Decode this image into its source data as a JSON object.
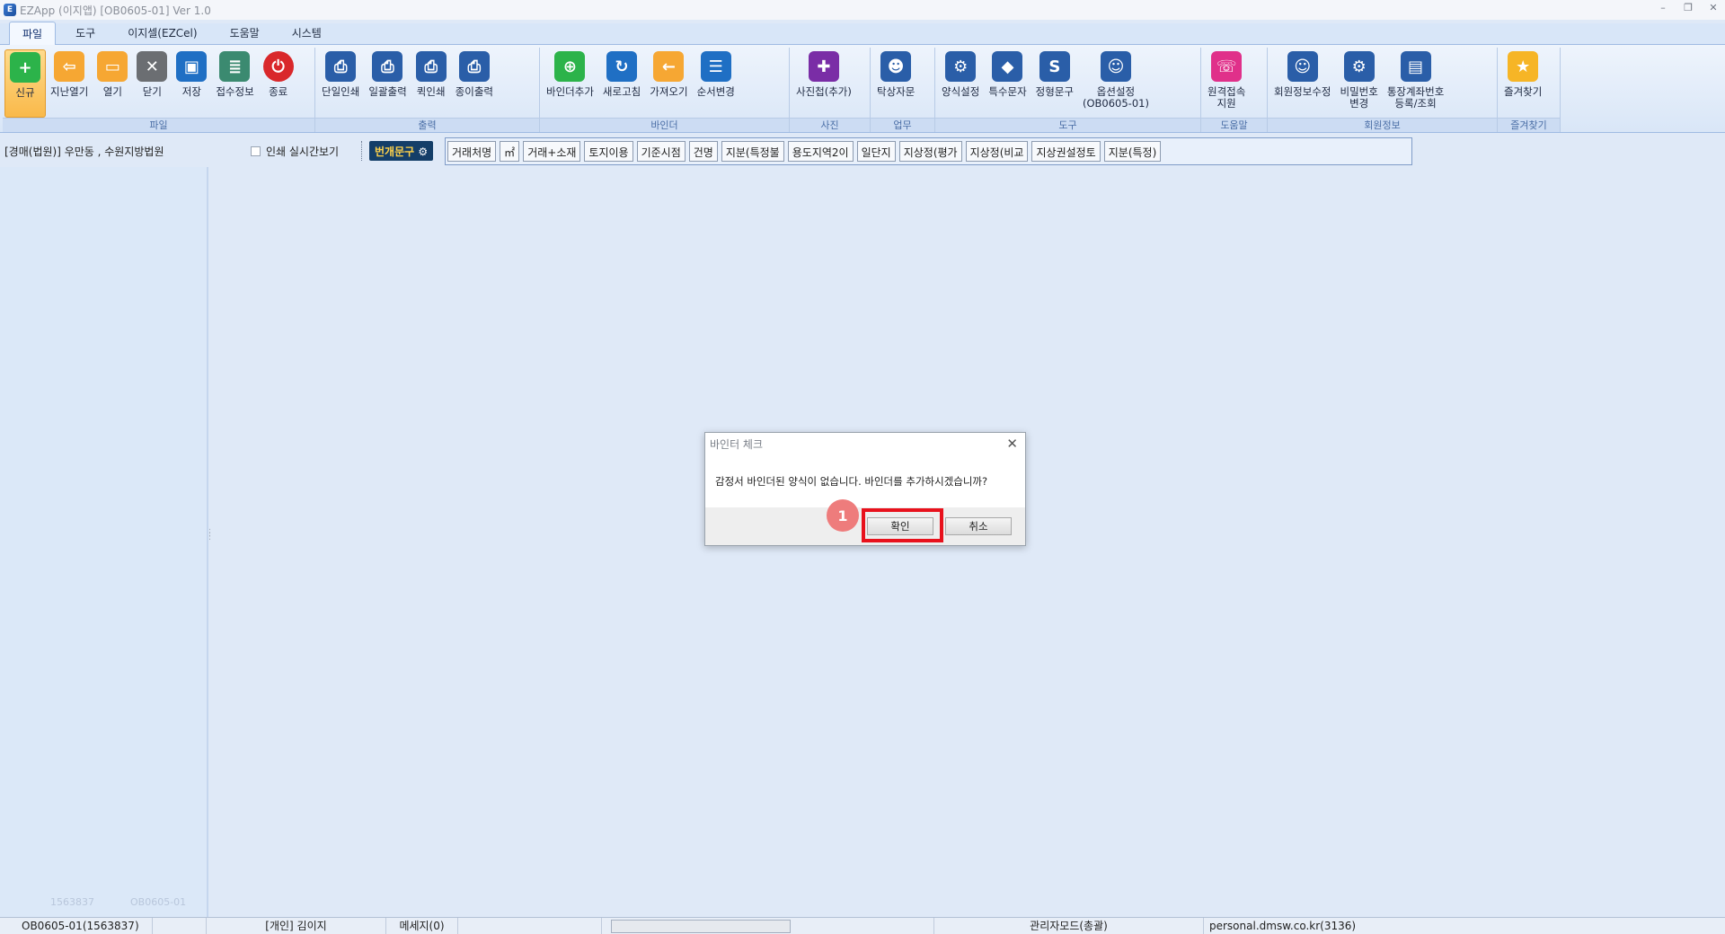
{
  "window": {
    "title": "EZApp (이지앱) [OB0605-01] Ver 1.0",
    "icon": "ez-logo"
  },
  "menu": {
    "tabs": [
      "파일",
      "도구",
      "이지셀(EZCel)",
      "도움말",
      "시스템"
    ],
    "active": 0
  },
  "ribbon": {
    "groups": [
      {
        "label": "파일",
        "buttons": [
          "신규",
          "지난열기",
          "열기",
          "닫기",
          "저장",
          "접수정보",
          "종료"
        ]
      },
      {
        "label": "출력",
        "buttons": [
          "단일인쇄",
          "일괄출력",
          "퀵인쇄",
          "종이출력"
        ]
      },
      {
        "label": "바인더",
        "buttons": [
          "바인더추가",
          "새로고침",
          "가져오기",
          "순서변경"
        ]
      },
      {
        "label": "사진",
        "buttons": [
          "사진첩(추가)"
        ]
      },
      {
        "label": "업무",
        "buttons": [
          "탁상자문"
        ]
      },
      {
        "label": "도구",
        "buttons": [
          "양식설정",
          "특수문자",
          "정형문구",
          "옵션설정",
          "(OB0605-01)"
        ]
      },
      {
        "label": "도움말",
        "buttons": [
          "원격접속",
          "지원"
        ]
      },
      {
        "label": "회원정보",
        "buttons": [
          "회원정보수정",
          "비밀번호",
          "변경",
          "통장계좌번호",
          "등록/조회"
        ]
      },
      {
        "label": "즐겨찾기",
        "buttons": [
          "즐겨찾기"
        ]
      }
    ]
  },
  "toolbar": {
    "breadcrumb": "[경매(법원)] 우만동 , 수원지방법원",
    "preview_label": "인쇄 실시간보기",
    "phrase_button": "번개문구",
    "phrases": [
      "거래처명",
      "㎡",
      "거래+소재",
      "토지이용",
      "기준시점",
      "건명",
      "지분(특정불",
      "용도지역2이",
      "일단지",
      "지상정(평가",
      "지상정(비교",
      "지상권설정토",
      "지분(특정)"
    ]
  },
  "sidebar": {
    "footer_left": "1563837",
    "footer_right": "OB0605-01"
  },
  "dialog": {
    "title": "바인터 체크",
    "message": "감정서 바인더된 양식이 없습니다. 바인더를 추가하시겠습니까?",
    "ok": "확인",
    "cancel": "취소",
    "step_number": "1"
  },
  "status": {
    "id": "OB0605-01(1563837)",
    "user": "[개인] 김이지",
    "messages": "메세지(0)",
    "mode": "관리자모드(총괄)",
    "site": "personal.dmsw.co.kr(3136)"
  }
}
